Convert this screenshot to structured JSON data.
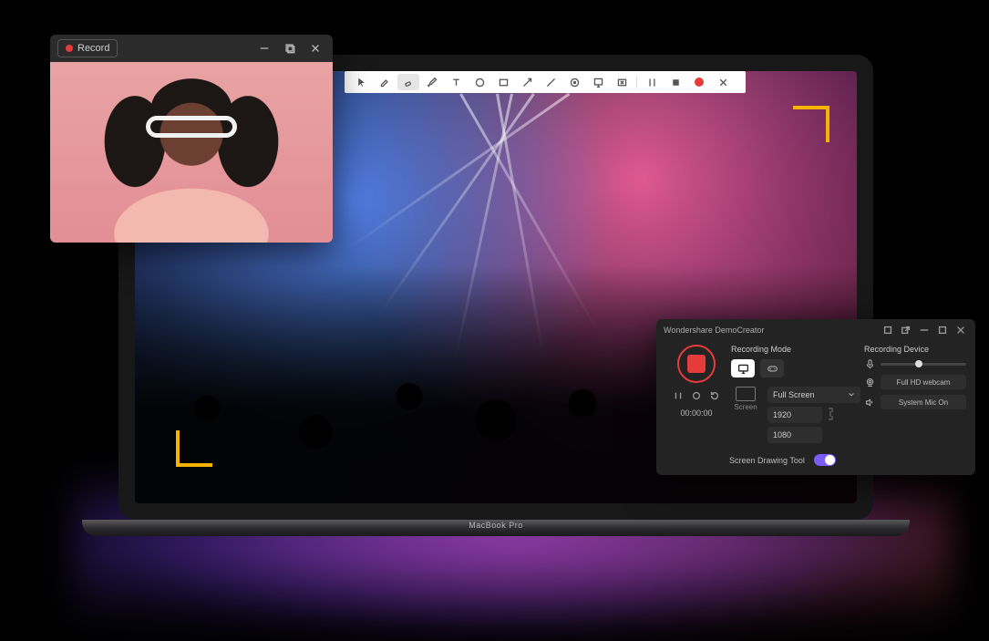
{
  "record_window": {
    "title": "Record",
    "controls": {
      "minimize": "–",
      "maximize": "▢",
      "close": "×"
    }
  },
  "laptop": {
    "brand": "MacBook Pro"
  },
  "annotation_toolbar": {
    "tools": [
      "cursor",
      "highlighter",
      "eraser",
      "marker",
      "text",
      "circle",
      "rectangle",
      "arrow",
      "line",
      "spotlight",
      "whiteboard",
      "magnifier"
    ],
    "right": [
      "pause",
      "stop",
      "record",
      "close"
    ]
  },
  "demo_panel": {
    "title": "Wondershare DemoCreator",
    "window_controls": [
      "pin",
      "popout",
      "minimize",
      "maximize",
      "close"
    ],
    "timer": "00:00:00",
    "recording_mode_label": "Recording Mode",
    "modes": {
      "screen": "screen",
      "game": "game"
    },
    "screen": {
      "label": "Screen",
      "preset": "Full Screen",
      "width": "1920",
      "height": "1080"
    },
    "recording_device_label": "Recording Device",
    "devices": {
      "mic": "mic",
      "webcam_label": "Full HD webcam",
      "speaker_label": "System Mic On"
    },
    "drawing_tool_label": "Screen Drawing Tool"
  }
}
